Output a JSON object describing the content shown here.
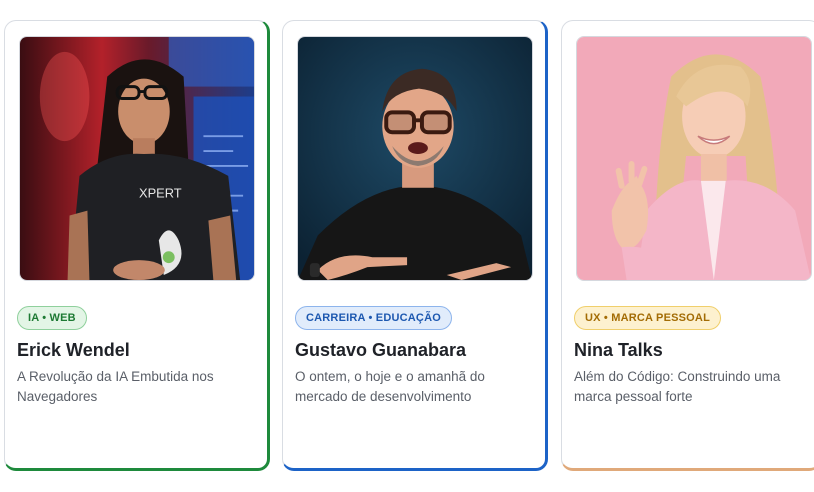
{
  "speakers": [
    {
      "tag": "IA • WEB",
      "name": "Erick Wendel",
      "talk": "A Revolução da IA Embutida nos Navegadores",
      "shirt_text": "XPERT",
      "accent": "#1e8a3c"
    },
    {
      "tag": "CARREIRA • EDUCAÇÃO",
      "name": "Gustavo Guanabara",
      "talk": "O ontem, o hoje e o amanhã do mercado de desenvolvimento",
      "accent": "#1d63c7"
    },
    {
      "tag": "UX • MARCA PESSOAL",
      "name": "Nina Talks",
      "talk": "Além do Código: Construindo uma marca pessoal forte",
      "accent": "#e0a97a"
    }
  ]
}
